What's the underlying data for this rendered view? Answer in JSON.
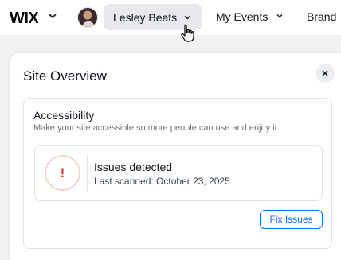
{
  "topbar": {
    "logo_text": "WIX",
    "site_name": "Lesley Beats",
    "nav": [
      {
        "label": "My Events"
      },
      {
        "label": "Brand"
      }
    ]
  },
  "panel": {
    "title": "Site Overview",
    "accessibility": {
      "title": "Accessibility",
      "description": "Make your site accessible so more people can use and enjoy it.",
      "alert_symbol": "!",
      "issue_title": "Issues detected",
      "issue_subtitle": "Last scanned: October 23, 2025",
      "button_label": "Fix Issues"
    }
  },
  "colors": {
    "accent": "#116dff",
    "alert": "#e0382b",
    "hover_bg": "#e7e9ec"
  },
  "icons": [
    "chevron-down-icon",
    "close-icon",
    "hand-pointer-icon",
    "alert-icon"
  ]
}
